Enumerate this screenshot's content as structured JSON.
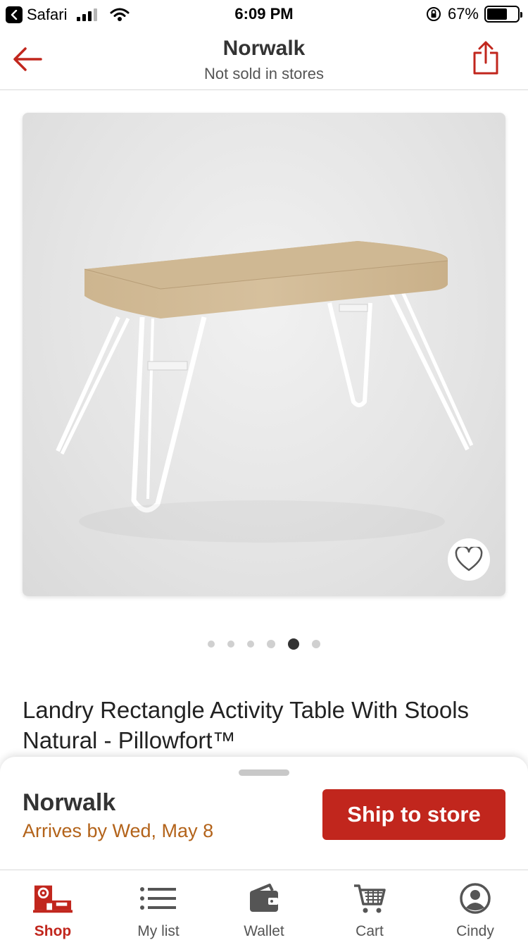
{
  "status_bar": {
    "app": "Safari",
    "time": "6:09 PM",
    "battery": "67%"
  },
  "header": {
    "title": "Norwalk",
    "subtitle": "Not sold in stores"
  },
  "gallery": {
    "image_count": 6,
    "active_index": 4
  },
  "product": {
    "title": "Landry Rectangle Activity Table With Stools Natural - Pillowfort™"
  },
  "fulfillment": {
    "store": "Norwalk",
    "arrival": "Arrives by Wed, May 8",
    "button_label": "Ship to store"
  },
  "tabs": [
    {
      "label": "Shop",
      "icon": "target-store-icon",
      "active": true
    },
    {
      "label": "My list",
      "icon": "list-icon",
      "active": false
    },
    {
      "label": "Wallet",
      "icon": "wallet-icon",
      "active": false
    },
    {
      "label": "Cart",
      "icon": "cart-icon",
      "active": false
    },
    {
      "label": "Cindy",
      "icon": "account-icon",
      "active": false
    }
  ],
  "colors": {
    "brand_red": "#c1261d",
    "arrival_orange": "#b3631a"
  }
}
